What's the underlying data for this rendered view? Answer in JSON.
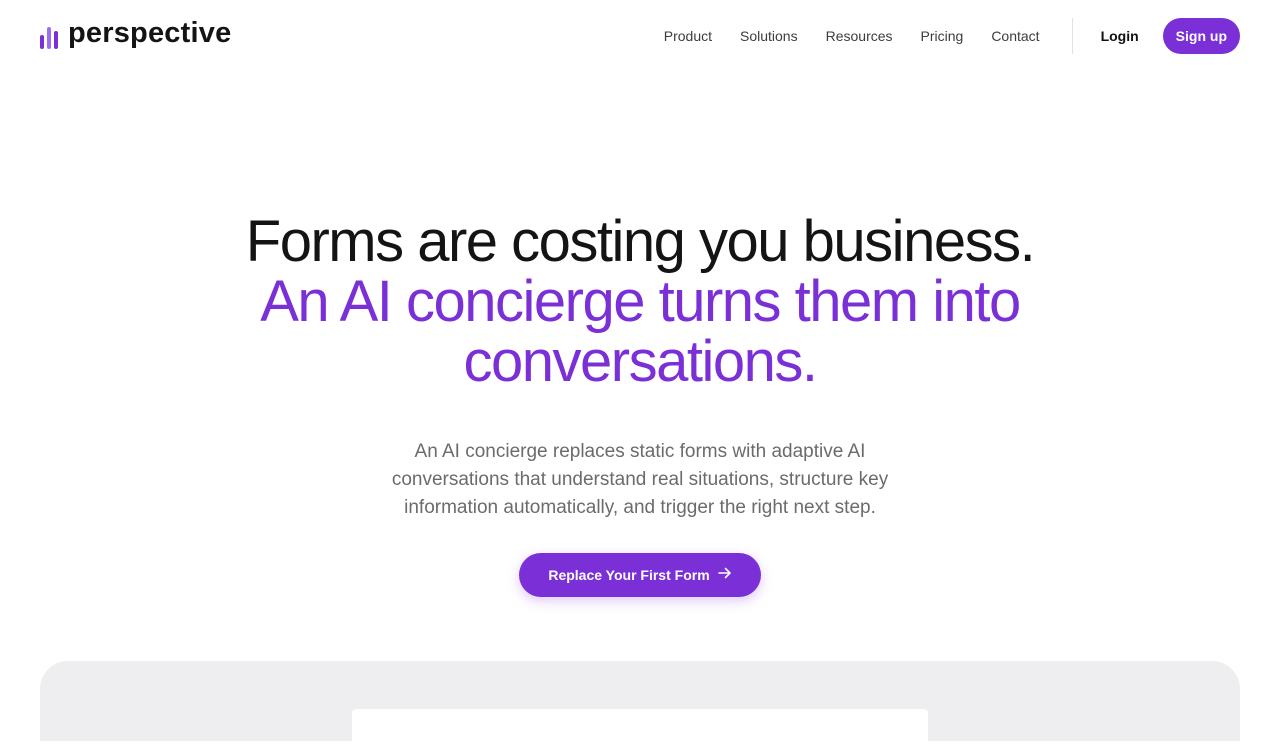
{
  "brand": {
    "name": "perspective",
    "accent": "#7b2fd6",
    "logo_icon": "bars-logo-icon"
  },
  "nav": {
    "links": [
      "Product",
      "Solutions",
      "Resources",
      "Pricing",
      "Contact"
    ],
    "login": "Login",
    "signup": "Sign up"
  },
  "hero": {
    "line1": "Forms are costing you business.",
    "line2": "An AI concierge turns them into",
    "line3": "conversations.",
    "subtitle": "An AI concierge replaces static forms with adaptive AI conversations that understand real situations, structure key information automatically, and trigger the right next step.",
    "cta": "Replace Your First Form",
    "cta_icon": "arrow-right-icon"
  }
}
